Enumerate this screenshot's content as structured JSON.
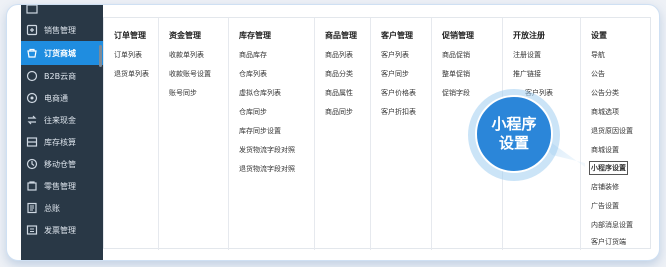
{
  "sidebar": {
    "items": [
      {
        "label": "",
        "icon": "store-icon"
      },
      {
        "label": "销售管理",
        "icon": "sales-icon"
      },
      {
        "label": "订货商城",
        "icon": "mall-icon",
        "active": true
      },
      {
        "label": "B2B云商",
        "icon": "cloud-icon"
      },
      {
        "label": "电商通",
        "icon": "ecommerce-icon"
      },
      {
        "label": "往来现金",
        "icon": "cash-icon"
      },
      {
        "label": "库存核算",
        "icon": "inventory-icon"
      },
      {
        "label": "移动仓管",
        "icon": "mobile-warehouse-icon"
      },
      {
        "label": "零售管理",
        "icon": "retail-icon"
      },
      {
        "label": "总账",
        "icon": "ledger-icon"
      },
      {
        "label": "发票管理",
        "icon": "invoice-icon"
      }
    ]
  },
  "menu": {
    "columns": [
      {
        "header": "订单管理",
        "items": [
          "订单列表",
          "退货单列表"
        ]
      },
      {
        "header": "资金管理",
        "items": [
          "收款单列表",
          "收款账号设置",
          "账号同步"
        ]
      },
      {
        "header": "库存管理",
        "items": [
          "商品库存",
          "仓库列表",
          "虚拟仓库列表",
          "仓库同步",
          "库存同步设置",
          "发货物流字段对照",
          "退货物流字段对照"
        ]
      },
      {
        "header": "商品管理",
        "items": [
          "商品列表",
          "商品分类",
          "商品属性",
          "商品同步"
        ]
      },
      {
        "header": "客户管理",
        "items": [
          "客户列表",
          "客户同步",
          "客户价格表",
          "客户折扣表"
        ]
      },
      {
        "header": "促销管理",
        "items": [
          "商品促销",
          "整单促销",
          "促销字段"
        ]
      },
      {
        "header": "开放注册",
        "items": [
          "注册设置",
          "推广链接",
          "客户列表"
        ]
      },
      {
        "header": "设置",
        "items": [
          "导航",
          "公告",
          "公告分类",
          "商城选项",
          "退货原因设置",
          "商城设置",
          "小程序设置",
          "店铺装修",
          "广告设置",
          "内部消息设置",
          "客户订货端"
        ]
      }
    ]
  },
  "callout": {
    "line1": "小程序",
    "line2": "设置"
  },
  "colors": {
    "sidebar_bg": "#293846",
    "active": "#1f8de0",
    "callout": "#2b86d9"
  }
}
